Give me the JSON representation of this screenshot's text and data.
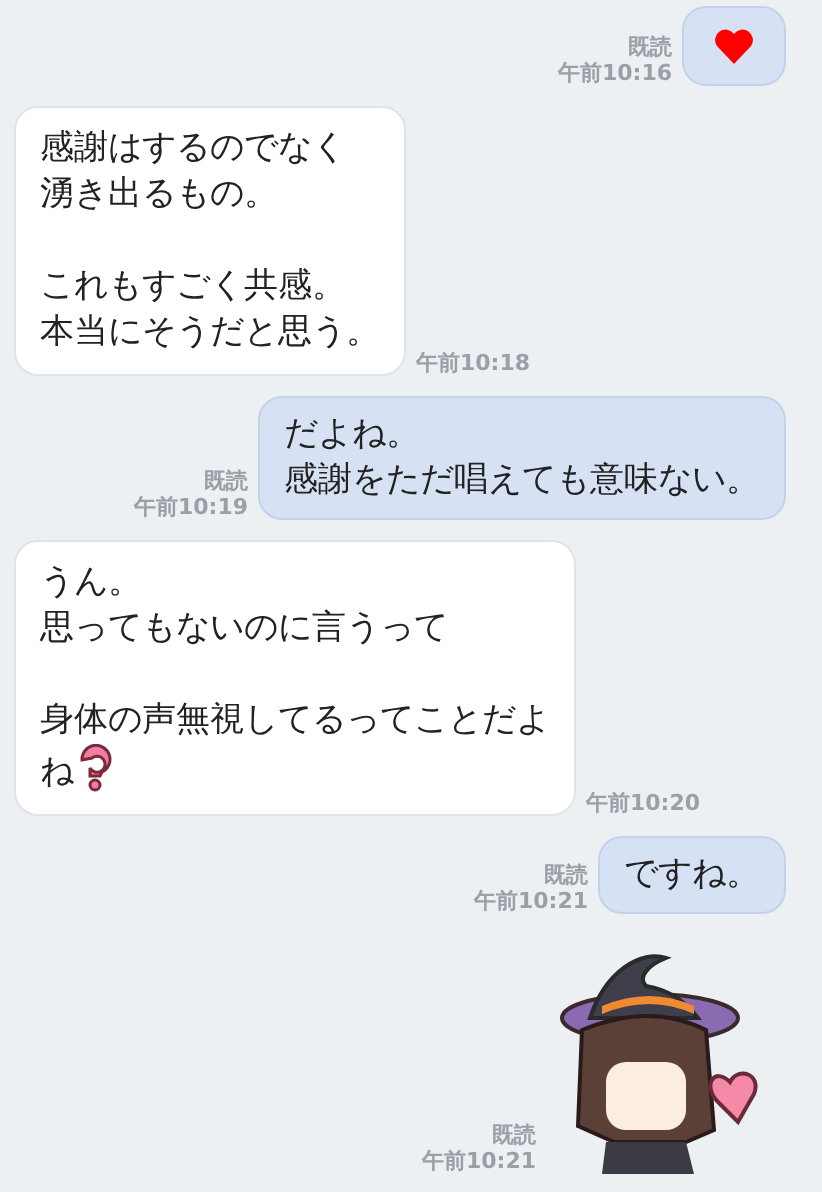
{
  "messages": [
    {
      "sent": true,
      "kind": "heart",
      "read_label": "既読",
      "time": "午前10:16"
    },
    {
      "sent": false,
      "kind": "text",
      "paragraphs": [
        [
          "感謝はするのでなく",
          "湧き出るもの。"
        ],
        [
          "これもすごく共感。",
          "本当にそうだと思う。"
        ]
      ],
      "time": "午前10:18"
    },
    {
      "sent": true,
      "kind": "text",
      "paragraphs": [
        [
          "だよね。",
          "感謝をただ唱えても意味ない。"
        ]
      ],
      "read_label": "既読",
      "time": "午前10:19"
    },
    {
      "sent": false,
      "kind": "text",
      "paragraphs": [
        [
          "うん。",
          "思ってもないのに言うって"
        ],
        [
          "身体の声無視してるってことだよ",
          "ね"
        ]
      ],
      "has_emoji": true,
      "time": "午前10:20"
    },
    {
      "sent": true,
      "kind": "text",
      "paragraphs": [
        [
          "ですね。"
        ]
      ],
      "read_label": "既読",
      "time": "午前10:21"
    },
    {
      "sent": true,
      "kind": "sticker",
      "read_label": "既読",
      "time": "午前10:21"
    }
  ]
}
